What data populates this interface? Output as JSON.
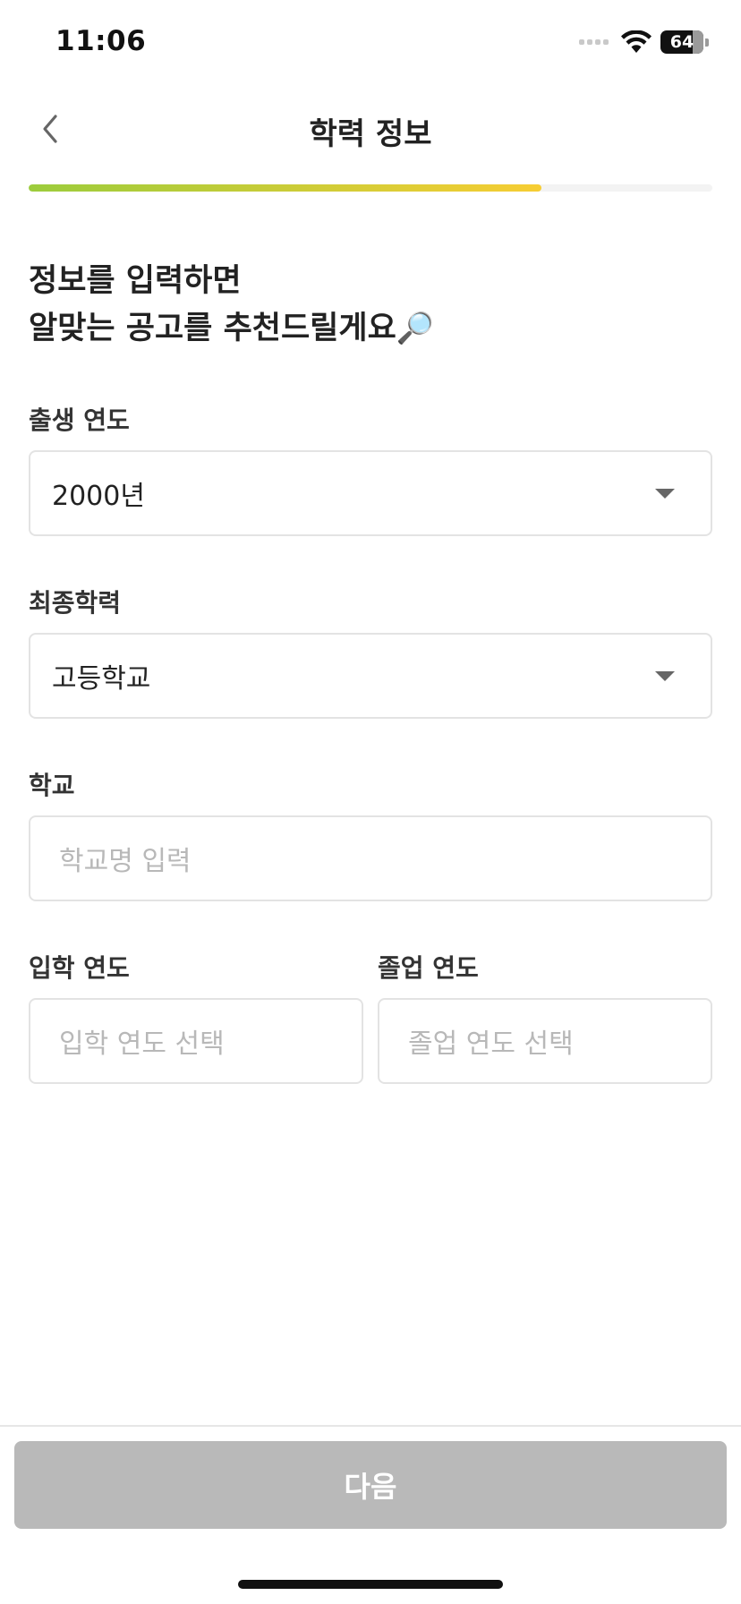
{
  "status_bar": {
    "time": "11:06",
    "battery": "64"
  },
  "header": {
    "title": "학력 정보",
    "back_icon": "chevron-left-icon"
  },
  "progress": {
    "fraction": 0.75
  },
  "headline": {
    "line1": "정보를 입력하면",
    "line2": "알맞는 공고를 추천드릴게요",
    "emoji": "🔎"
  },
  "form": {
    "birth_year": {
      "label": "출생 연도",
      "value": "2000년"
    },
    "education": {
      "label": "최종학력",
      "value": "고등학교"
    },
    "school": {
      "label": "학교",
      "placeholder": "학교명 입력"
    },
    "admission_year": {
      "label": "입학 연도",
      "placeholder": "입학 연도 선택"
    },
    "graduation_year": {
      "label": "졸업 연도",
      "placeholder": "졸업 연도 선택"
    }
  },
  "footer": {
    "next_label": "다음",
    "next_button_color": "#b9b9b9"
  },
  "colors": {
    "progress_start": "#9ccc3c",
    "progress_end": "#f7cd33"
  }
}
